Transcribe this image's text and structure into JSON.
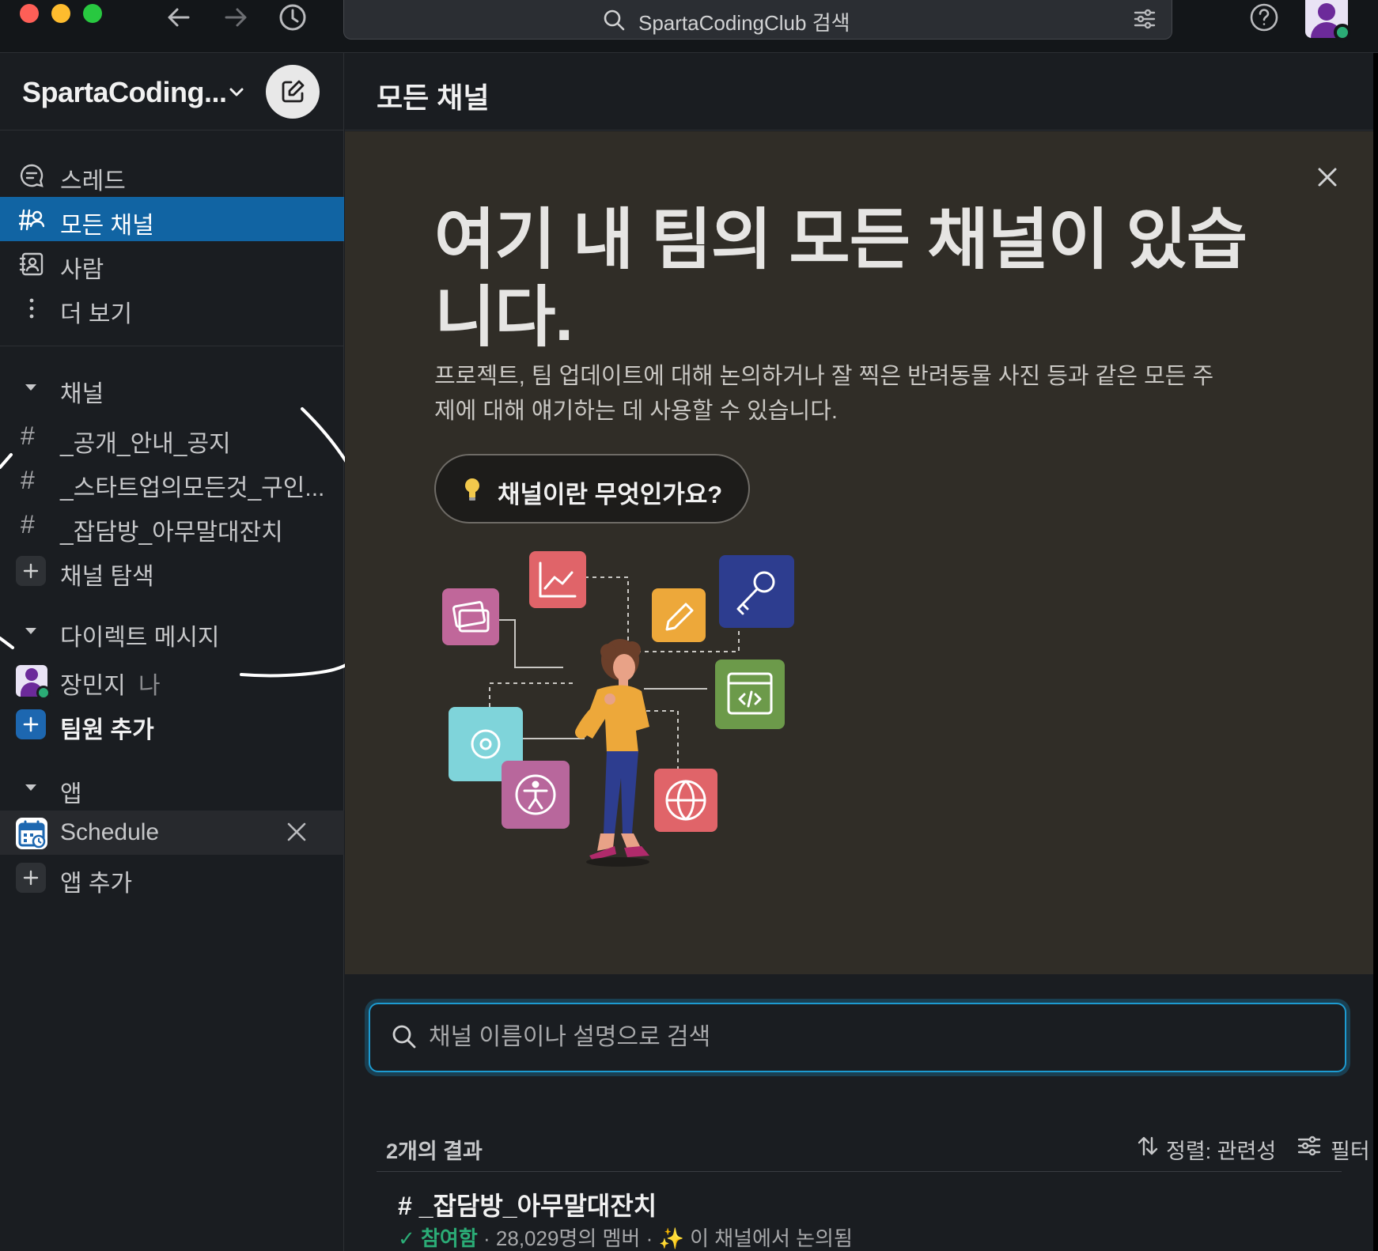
{
  "topbar": {
    "search_text": "SpartaCodingClub 검색"
  },
  "sidebar": {
    "workspace_name": "SpartaCoding...",
    "nav": [
      {
        "label": "스레드",
        "icon": "threads-icon"
      },
      {
        "label": "모든 채널",
        "icon": "channel-browser-icon",
        "active": true
      },
      {
        "label": "사람",
        "icon": "people-icon"
      },
      {
        "label": "더 보기",
        "icon": "more-vertical-icon"
      }
    ],
    "channels_section": "채널",
    "channels": [
      "_공개_안내_공지",
      "_스타트업의모든것_구인...",
      "_잡담방_아무말대잔치"
    ],
    "browse_channels": "채널 탐색",
    "dm_section": "다이렉트 메시지",
    "dm_user": "장민지",
    "dm_me": "나",
    "add_teammates": "팀원 추가",
    "apps_section": "앱",
    "app_name": "Schedule",
    "add_app": "앱 추가"
  },
  "main": {
    "title": "모든 채널",
    "hero": {
      "title": "여기 내 팀의 모든 채널이 있습니다.",
      "description": "프로젝트, 팀 업데이트에 대해 논의하거나 잘 찍은 반려동물 사진 등과 같은 모든 주제에 대해 얘기하는 데 사용할 수 있습니다.",
      "button_label": "채널이란 무엇인가요?"
    },
    "search_placeholder": "채널 이름이나 설명으로 검색",
    "results_count": "2개의 결과",
    "sort_label": "정렬: 관련성",
    "filter_label": "필터",
    "result": {
      "name": "# _잡담방_아무말대잔치",
      "joined": "참여함",
      "members": "28,029명의 멤버",
      "activity": "이 채널에서 논의됨"
    }
  },
  "colors": {
    "sidebar_bg": "#1a1d21",
    "active_item": "#1164a3",
    "hero_bg": "#302d27",
    "presence": "#2bac76",
    "search_focus": "#1d9bd1"
  }
}
